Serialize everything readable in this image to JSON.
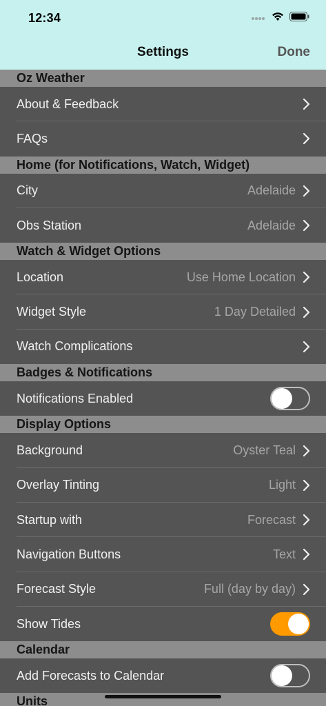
{
  "status": {
    "time": "12:34"
  },
  "nav": {
    "title": "Settings",
    "done": "Done"
  },
  "sections": [
    {
      "header": "Oz Weather",
      "rows": [
        {
          "label": "About & Feedback",
          "value": "",
          "type": "chevron"
        },
        {
          "label": "FAQs",
          "value": "",
          "type": "chevron"
        }
      ]
    },
    {
      "header": "Home (for Notifications, Watch, Widget)",
      "rows": [
        {
          "label": "City",
          "value": "Adelaide",
          "type": "chevron"
        },
        {
          "label": "Obs Station",
          "value": "Adelaide",
          "type": "chevron"
        }
      ]
    },
    {
      "header": "Watch & Widget Options",
      "rows": [
        {
          "label": "Location",
          "value": "Use Home Location",
          "type": "chevron"
        },
        {
          "label": "Widget Style",
          "value": "1 Day Detailed",
          "type": "chevron"
        },
        {
          "label": "Watch Complications",
          "value": "",
          "type": "chevron"
        }
      ]
    },
    {
      "header": "Badges & Notifications",
      "rows": [
        {
          "label": "Notifications Enabled",
          "type": "toggle",
          "on": false
        }
      ]
    },
    {
      "header": "Display Options",
      "rows": [
        {
          "label": "Background",
          "value": "Oyster Teal",
          "type": "chevron"
        },
        {
          "label": "Overlay Tinting",
          "value": "Light",
          "type": "chevron"
        },
        {
          "label": "Startup with",
          "value": "Forecast",
          "type": "chevron"
        },
        {
          "label": "Navigation Buttons",
          "value": "Text",
          "type": "chevron"
        },
        {
          "label": "Forecast Style",
          "value": "Full (day by day)",
          "type": "chevron"
        },
        {
          "label": "Show Tides",
          "type": "toggle",
          "on": true
        }
      ]
    },
    {
      "header": "Calendar",
      "rows": [
        {
          "label": "Add Forecasts to Calendar",
          "type": "toggle",
          "on": false
        }
      ]
    },
    {
      "header": "Units",
      "rows": []
    }
  ],
  "colors": {
    "nav_bg": "#c6f1ee",
    "section_bg": "#8d8d8d",
    "row_bg": "#545454",
    "toggle_on": "#ff9a00"
  }
}
